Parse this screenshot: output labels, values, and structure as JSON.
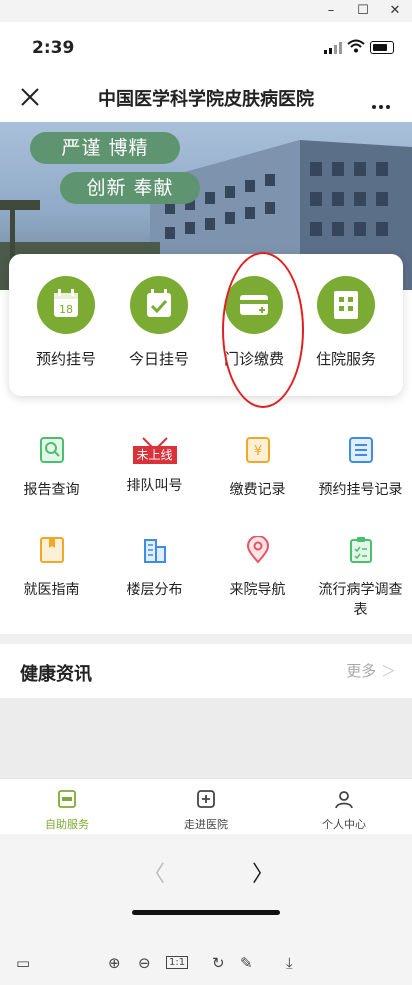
{
  "status": {
    "time": "2:39"
  },
  "nav": {
    "title": "中国医学科学院皮肤病医院"
  },
  "banner": {
    "slogan1": "严谨 博精",
    "slogan2": "创新 奉献"
  },
  "quick": [
    {
      "label": "预约挂号",
      "icon": "calendar-18-icon",
      "day": "18"
    },
    {
      "label": "今日挂号",
      "icon": "calendar-check-icon"
    },
    {
      "label": "门诊缴费",
      "icon": "card-plus-icon"
    },
    {
      "label": "住院服务",
      "icon": "building-grid-icon"
    }
  ],
  "grid": [
    {
      "label": "报告查询",
      "icon": "search-report-icon"
    },
    {
      "label": "排队叫号",
      "icon": "queue-icon",
      "badge": "未上线"
    },
    {
      "label": "缴费记录",
      "icon": "yen-record-icon"
    },
    {
      "label": "预约挂号记录",
      "icon": "list-record-icon"
    },
    {
      "label": "就医指南",
      "icon": "guide-book-icon"
    },
    {
      "label": "楼层分布",
      "icon": "floor-building-icon"
    },
    {
      "label": "来院导航",
      "icon": "location-pin-icon"
    },
    {
      "label": "流行病学调查表",
      "icon": "survey-clipboard-icon"
    }
  ],
  "news": {
    "title": "健康资讯",
    "more": "更多"
  },
  "tabs": [
    {
      "label": "自助服务",
      "icon": "self-service-icon",
      "active": true
    },
    {
      "label": "走进医院",
      "icon": "hospital-cross-icon",
      "active": false
    },
    {
      "label": "个人中心",
      "icon": "user-icon",
      "active": false
    }
  ],
  "browser": {
    "zoom_label": "1:1"
  },
  "colors": {
    "accent": "#7cab33",
    "tab_active": "#7cab33",
    "ring": "#e02020",
    "badge": "#d9323a"
  }
}
